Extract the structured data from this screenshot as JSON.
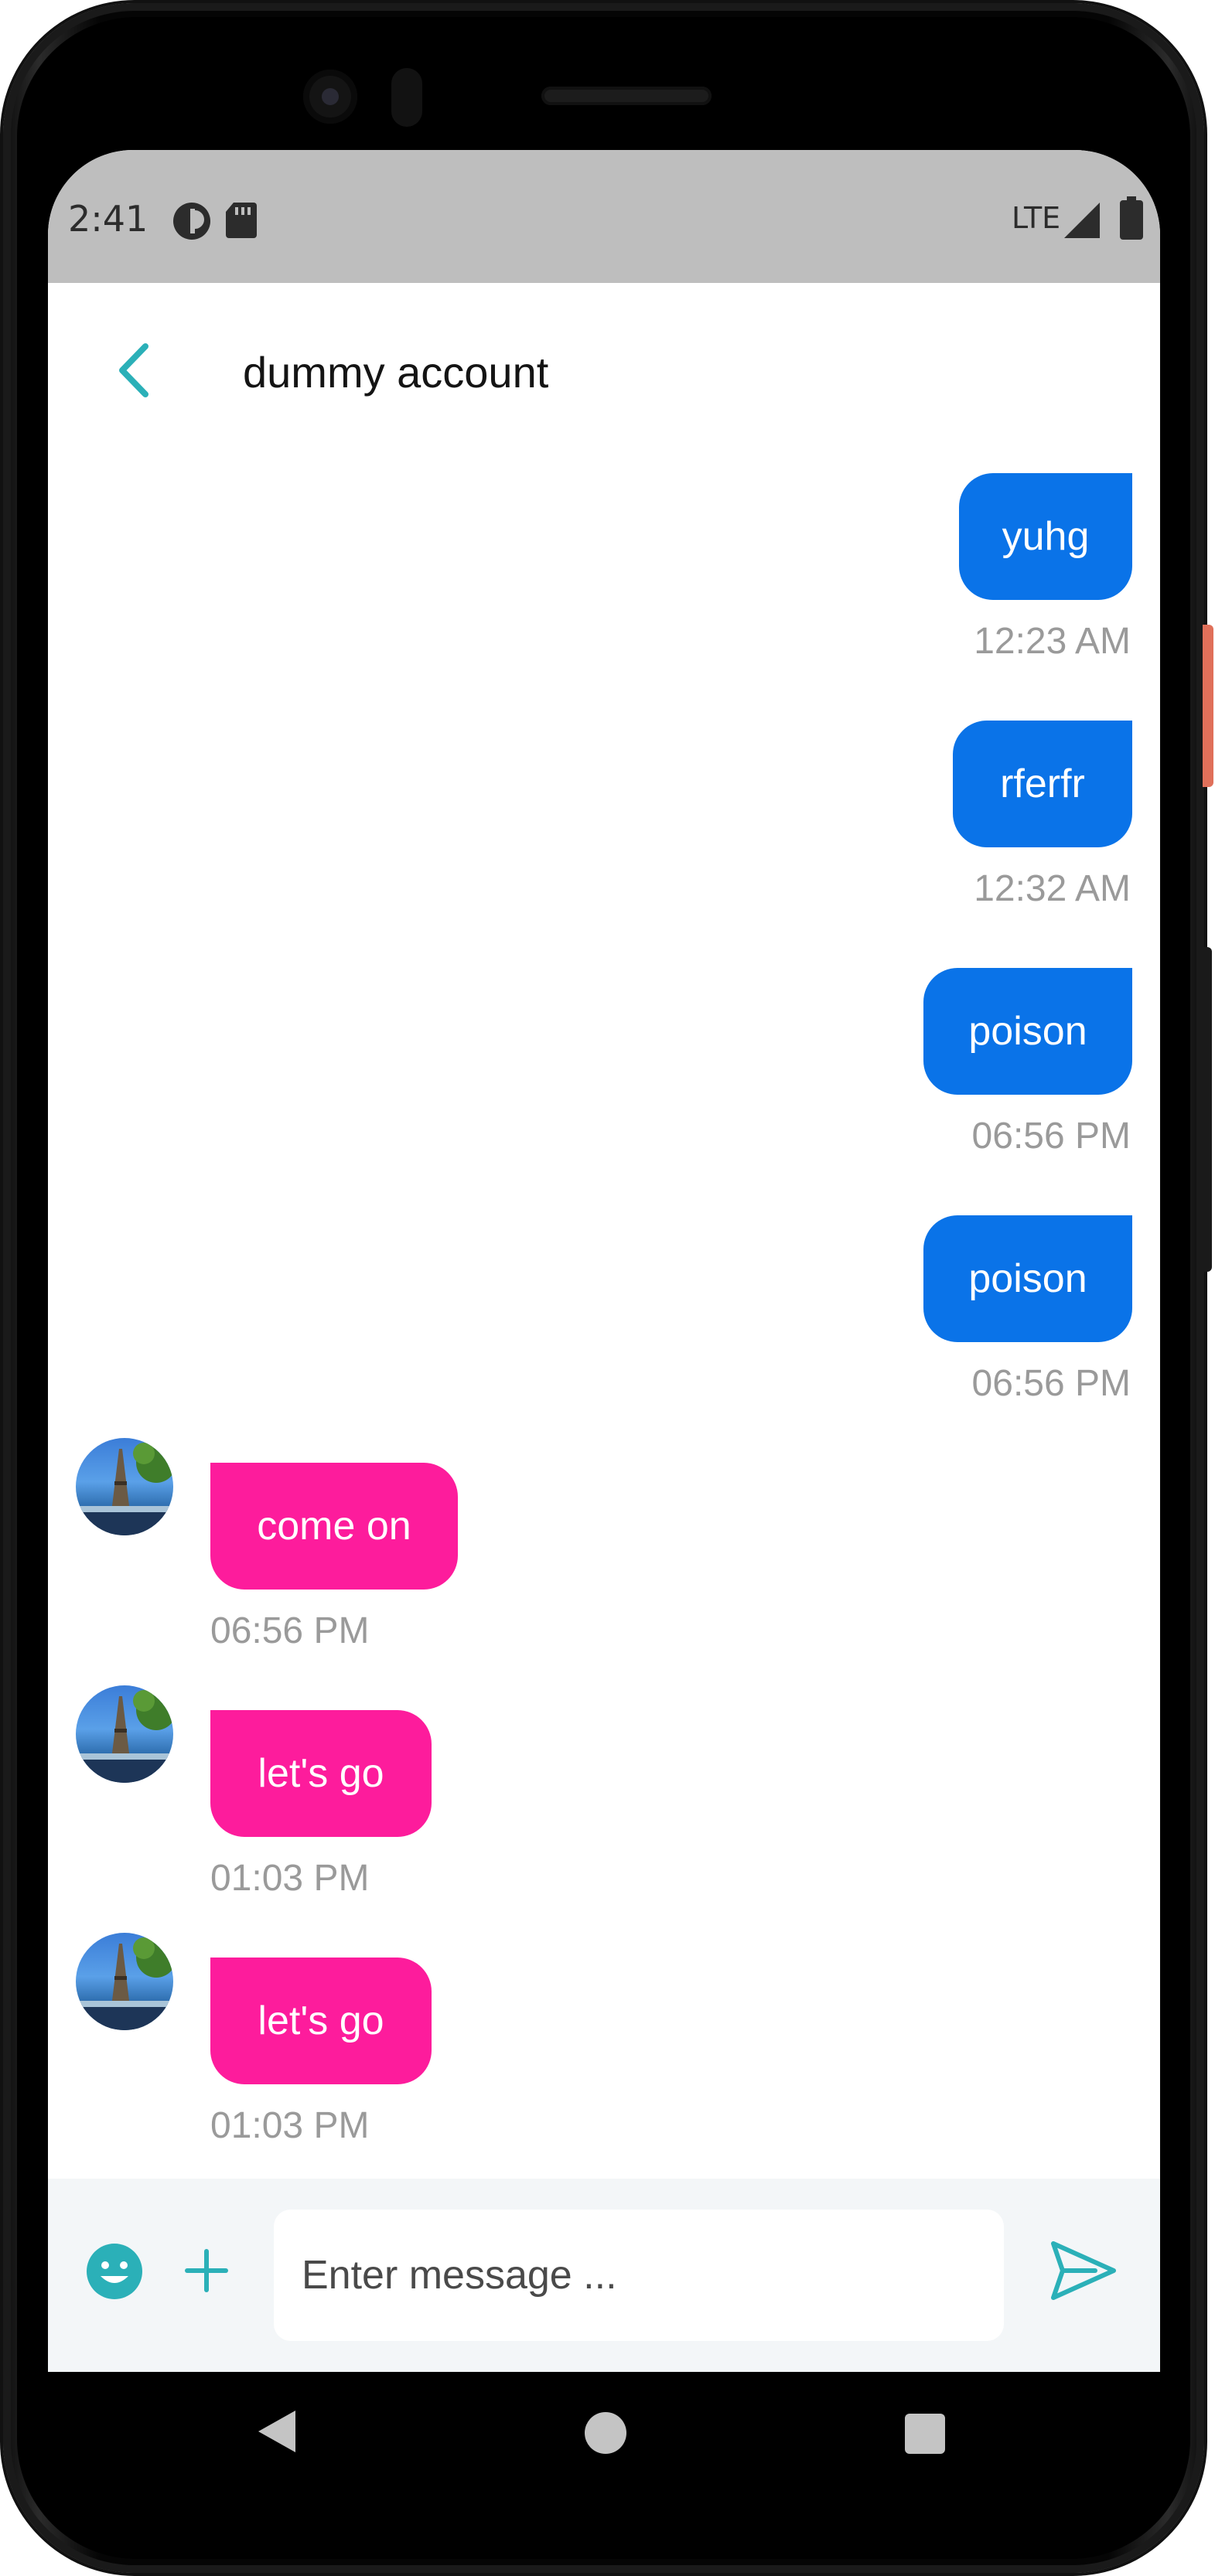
{
  "status_bar": {
    "time": "2:41",
    "network": "LTE",
    "icons": [
      "app-notification-icon",
      "sd-card-icon",
      "signal-icon",
      "battery-icon"
    ]
  },
  "header": {
    "title": "dummy account",
    "back_icon": "chevron-left-icon"
  },
  "messages": [
    {
      "direction": "outgoing",
      "text": "yuhg",
      "time": "12:23 AM"
    },
    {
      "direction": "outgoing",
      "text": "rferfr",
      "time": "12:32 AM"
    },
    {
      "direction": "outgoing",
      "text": "poison",
      "time": "06:56 PM"
    },
    {
      "direction": "outgoing",
      "text": "poison",
      "time": "06:56 PM"
    },
    {
      "direction": "incoming",
      "text": "come on",
      "time": "06:56 PM"
    },
    {
      "direction": "incoming",
      "text": "let's go",
      "time": "01:03 PM"
    },
    {
      "direction": "incoming",
      "text": "let's go",
      "time": "01:03 PM"
    }
  ],
  "composer": {
    "placeholder": "Enter message ...",
    "emoji_icon": "emoji-icon",
    "add_icon": "plus-icon",
    "send_icon": "send-icon"
  },
  "colors": {
    "outgoing_bubble": "#0a73e8",
    "incoming_bubble": "#fd1c9c",
    "accent": "#2bb0b8",
    "timestamp": "#9a9a9a",
    "status_bar": "#bebebe"
  },
  "system_nav": {
    "icons": [
      "nav-back-icon",
      "nav-home-icon",
      "nav-recents-icon"
    ]
  }
}
